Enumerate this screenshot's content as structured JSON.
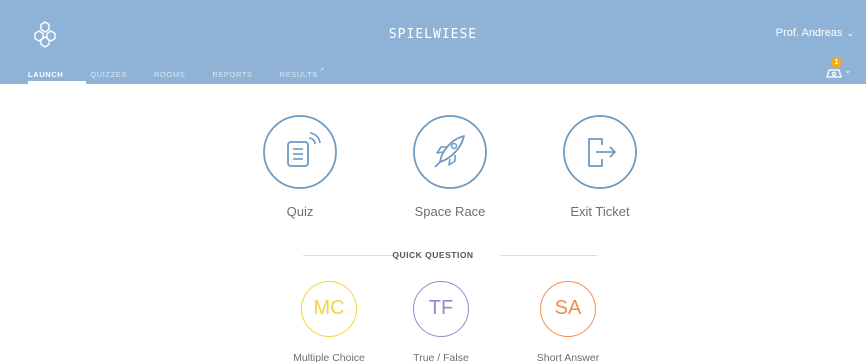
{
  "header": {
    "title": "SPIELWIESE",
    "user_name": "Prof. Andreas",
    "user_chevron": "⌄",
    "background": "#8fb3d6",
    "logo_icon": "hexagon-cluster-icon",
    "notification_count": "1"
  },
  "nav": {
    "tabs": [
      {
        "label": "LAUNCH",
        "active": true
      },
      {
        "label": "QUIZZES",
        "active": false
      },
      {
        "label": "ROOMS",
        "active": false
      },
      {
        "label": "REPORTS",
        "active": false
      },
      {
        "label": "RESULTS",
        "active": false
      }
    ]
  },
  "activities": [
    {
      "label": "Quiz",
      "icon": "quiz-document-icon"
    },
    {
      "label": "Space Race",
      "icon": "rocket-icon"
    },
    {
      "label": "Exit Ticket",
      "icon": "exit-door-icon"
    }
  ],
  "quick_question": {
    "title": "QUICK QUESTION",
    "options": [
      {
        "abbr": "MC",
        "label": "Multiple Choice",
        "color": "#f2d43f"
      },
      {
        "abbr": "TF",
        "label": "True / False",
        "color": "#9b84cf"
      },
      {
        "abbr": "SA",
        "label": "Short Answer",
        "color": "#f08d4d"
      }
    ]
  },
  "colors": {
    "accent_blue": "#6f9ac2"
  }
}
